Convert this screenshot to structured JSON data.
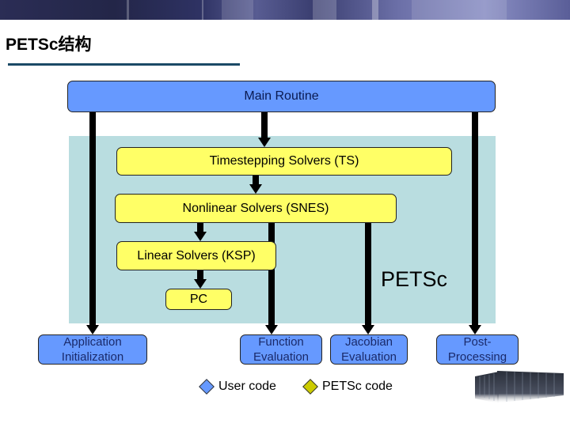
{
  "page": {
    "title": "PETSc结构"
  },
  "diagram": {
    "main_routine": "Main Routine",
    "timestepping": "Timestepping Solvers (TS)",
    "nonlinear": "Nonlinear Solvers (SNES)",
    "linear": "Linear Solvers (KSP)",
    "pc": "PC",
    "petsc_region_label": "PETSc",
    "user_boxes": {
      "app_init": [
        "Application",
        "Initialization"
      ],
      "function_eval": [
        "Function",
        "Evaluation"
      ],
      "jacobian_eval": [
        "Jacobian",
        "Evaluation"
      ],
      "post_processing": [
        "Post-",
        "Processing"
      ]
    }
  },
  "legend": {
    "user_code": {
      "label": "User code",
      "color": "#6699ff"
    },
    "petsc_code": {
      "label": "PETSc code",
      "color": "#cccc00"
    }
  },
  "colors": {
    "user_box": "#6699ff",
    "petsc_box": "#ffff66",
    "petsc_region": "#b9dde0",
    "title_rule": "#1b4a66"
  }
}
